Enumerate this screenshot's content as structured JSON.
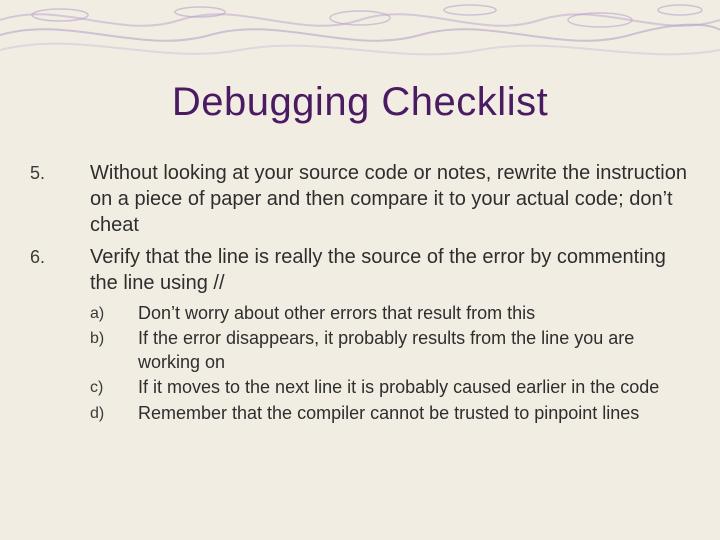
{
  "title": "Debugging Checklist",
  "items": [
    {
      "marker": "5.",
      "text": "Without looking at your source code or notes, rewrite the instruction on a piece of paper and then compare it to your actual code; don’t cheat"
    },
    {
      "marker": "6.",
      "text": "Verify that the line is really the source of the error by commenting the line using //"
    }
  ],
  "subitems": [
    {
      "marker": "a)",
      "text": "Don’t worry about other errors that result from this"
    },
    {
      "marker": "b)",
      "text": "If the error disappears, it probably results from the line you are working on"
    },
    {
      "marker": "c)",
      "text": "If it moves to the next line it is probably caused earlier in the code"
    },
    {
      "marker": "d)",
      "text": "Remember that the compiler cannot be trusted to pinpoint lines"
    }
  ]
}
